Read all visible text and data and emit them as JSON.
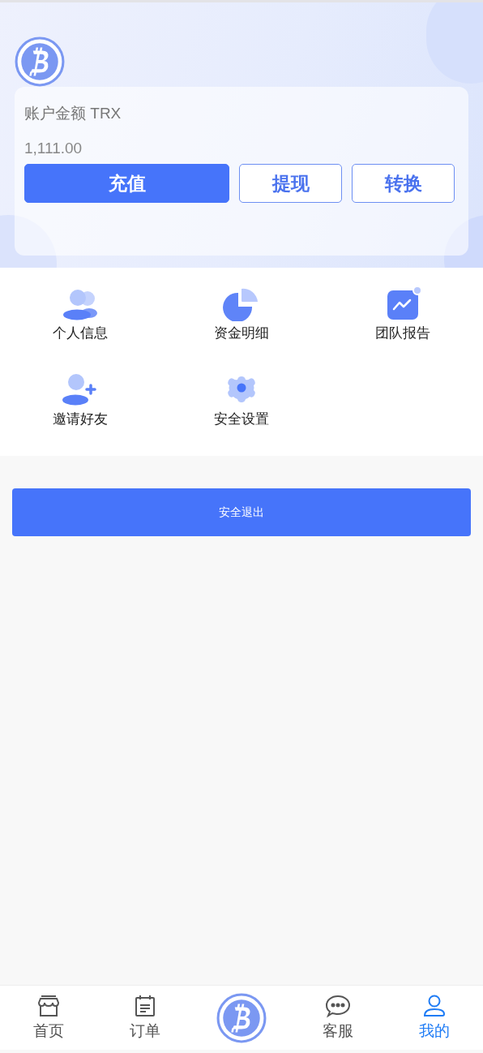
{
  "account": {
    "label": "账户金额 TRX",
    "balance": "1,111.00",
    "buttons": [
      {
        "label": "充值",
        "kind": "primary"
      },
      {
        "label": "提现",
        "kind": "outline"
      },
      {
        "label": "转换",
        "kind": "outline"
      }
    ]
  },
  "menu": [
    "个人信息",
    "资金明细",
    "团队报告",
    "邀请好友",
    "安全设置"
  ],
  "logout": "安全退出",
  "tabbar": [
    {
      "label": "首页",
      "selected": false
    },
    {
      "label": "订单",
      "selected": false
    },
    {
      "label": "客服",
      "selected": false
    },
    {
      "label": "我的",
      "selected": true
    }
  ]
}
